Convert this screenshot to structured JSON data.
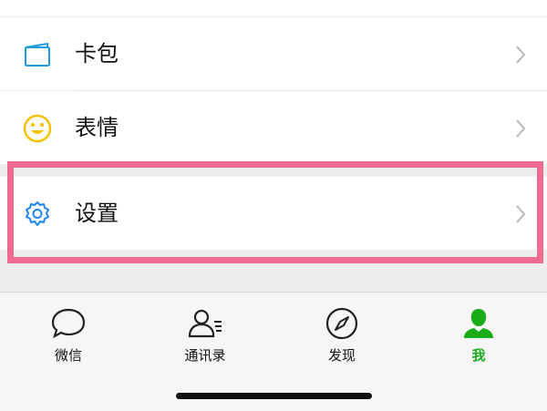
{
  "menu": {
    "items": [
      {
        "label": "卡包",
        "icon": "card-wallet-icon"
      },
      {
        "label": "表情",
        "icon": "smiley-face-icon"
      },
      {
        "label": "设置",
        "icon": "gear-icon",
        "highlighted": true
      }
    ]
  },
  "tabbar": {
    "tabs": [
      {
        "label": "微信",
        "icon": "chat-bubble-icon"
      },
      {
        "label": "通讯录",
        "icon": "contacts-icon"
      },
      {
        "label": "发现",
        "icon": "compass-icon"
      },
      {
        "label": "我",
        "icon": "person-icon",
        "active": true
      }
    ]
  },
  "colors": {
    "accent_green": "#1aad19",
    "highlight_pink": "#f06b92",
    "settings_blue": "#1f86f2",
    "smiley_yellow": "#f5c000",
    "card_blue": "#1a9be0"
  }
}
